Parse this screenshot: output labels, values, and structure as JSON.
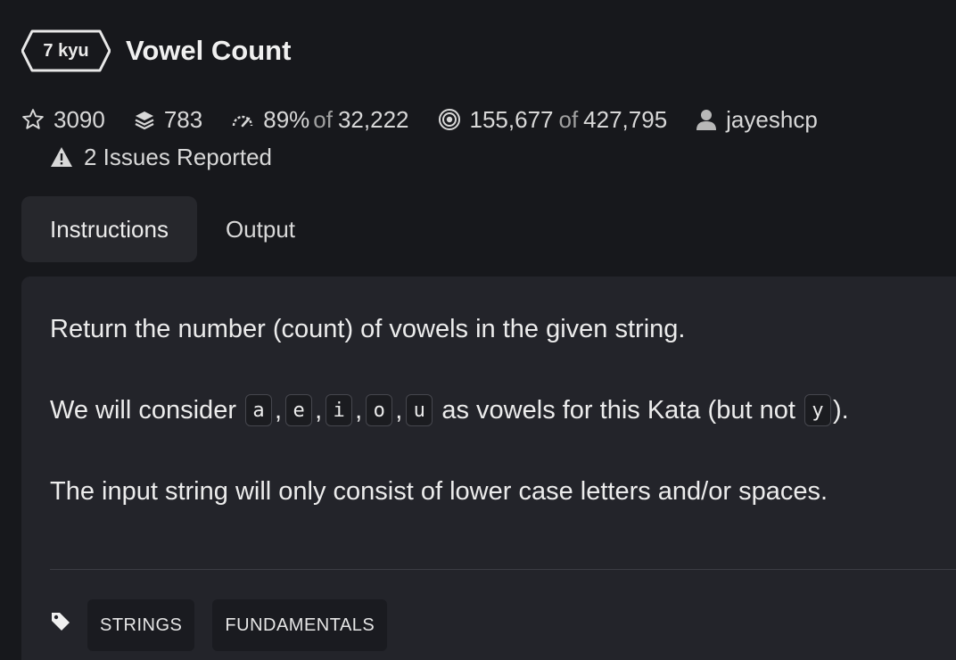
{
  "kata": {
    "rank": "7 kyu",
    "title": "Vowel Count"
  },
  "stats": {
    "stars": "3090",
    "collections": "783",
    "satisfaction_pct": "89%",
    "satisfaction_of": "of",
    "satisfaction_votes": "32,222",
    "completed": "155,677",
    "completed_of": "of",
    "attempted": "427,795",
    "author": "jayeshcp",
    "issues": "2 Issues Reported"
  },
  "tabs": [
    {
      "label": "Instructions",
      "active": true
    },
    {
      "label": "Output",
      "active": false
    }
  ],
  "description": {
    "p1": "Return the number (count) of vowels in the given string.",
    "p2_prefix": "We will consider",
    "vowels": [
      "a",
      "e",
      "i",
      "o",
      "u"
    ],
    "p2_middle": "as vowels for this Kata (but not",
    "excluded": "y",
    "p2_suffix": ").",
    "p3": "The input string will only consist of lower case letters and/or spaces."
  },
  "tags": [
    "STRINGS",
    "FUNDAMENTALS"
  ],
  "icons": {
    "rank": "hexagon-badge-icon",
    "stars": "star-icon",
    "collections": "stack-layers-icon",
    "satisfaction": "gauge-icon",
    "completed": "target-icon",
    "author": "user-icon",
    "issues": "warning-triangle-icon",
    "tags": "tag-icon"
  },
  "colors": {
    "background": "#17181c",
    "panel": "#23242a",
    "tab_active": "#26272c",
    "text": "#ebebeb"
  }
}
